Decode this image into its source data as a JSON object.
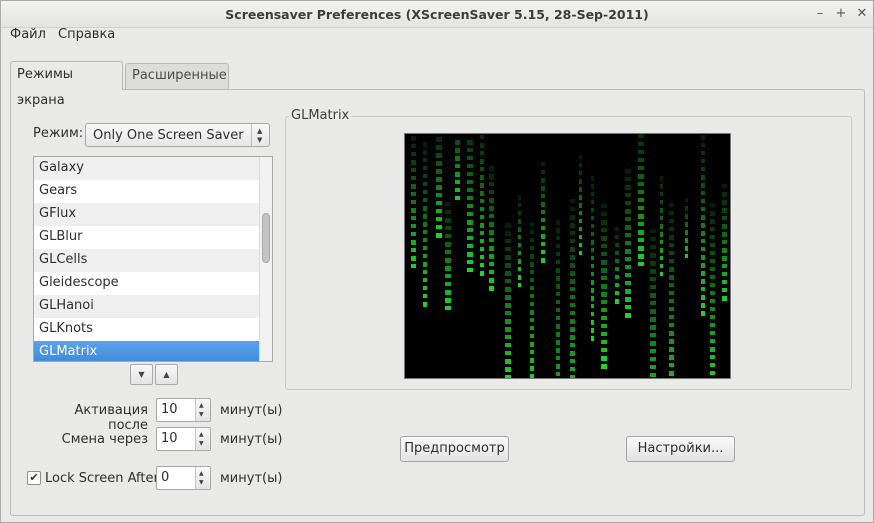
{
  "window": {
    "title": "Screensaver Preferences  (XScreenSaver 5.15, 28-Sep-2011)",
    "controls": {
      "minimize": "–",
      "maximize": "+",
      "close": "✕"
    }
  },
  "menu": {
    "file": "Файл",
    "help": "Справка"
  },
  "tabs": {
    "modes": "Режимы экрана",
    "advanced": "Расширенные"
  },
  "mode": {
    "label": "Режим:",
    "value": "Only One Screen Saver"
  },
  "savers": {
    "items": [
      "Galaxy",
      "Gears",
      "GFlux",
      "GLBlur",
      "GLCells",
      "Gleidescope",
      "GLHanoi",
      "GLKnots",
      "GLMatrix"
    ],
    "selected": "GLMatrix"
  },
  "timing": {
    "activate_label": "Активация после",
    "activate_value": "10",
    "cycle_label": "Смена через",
    "cycle_value": "10",
    "lock_label": "Lock Screen After",
    "lock_value": "0",
    "lock_checked": true,
    "unit": "минут(ы)"
  },
  "preview": {
    "title": "GLMatrix"
  },
  "buttons": {
    "preview": "Предпросмотр",
    "settings": "Настройки..."
  },
  "colors": {
    "selection": "#4a90d9",
    "matrix_green": "#1fd82a"
  }
}
